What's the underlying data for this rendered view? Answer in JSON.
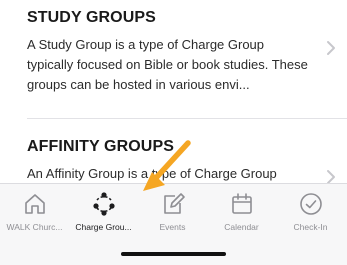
{
  "cards": [
    {
      "title": "STUDY GROUPS",
      "description": "A Study Group is a type of Charge Group typically focused on Bible or book studies. These groups can be hosted in various envi..."
    },
    {
      "title": "AFFINITY GROUPS",
      "description": "An Affinity Group is a type of Charge Group"
    }
  ],
  "tabbar": {
    "tabs": [
      {
        "label": "WALK Churc...",
        "icon": "home-icon"
      },
      {
        "label": "Charge Grou...",
        "icon": "groups-icon",
        "active": true
      },
      {
        "label": "Events",
        "icon": "edit-icon"
      },
      {
        "label": "Calendar",
        "icon": "calendar-icon"
      },
      {
        "label": "Check-In",
        "icon": "check-circle-icon"
      }
    ]
  },
  "colors": {
    "arrow": "#F5A623",
    "inactive_tab": "#8E8E93",
    "active_tab": "#1C1C1E"
  }
}
